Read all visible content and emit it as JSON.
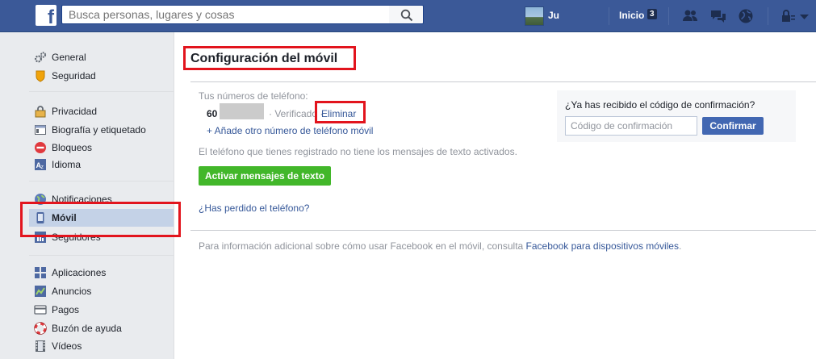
{
  "topbar": {
    "logo": "f",
    "search_placeholder": "Busca personas, lugares y cosas",
    "user_name": "Ju",
    "home_label": "Inicio",
    "home_count": "3",
    "icons": [
      "friends-icon",
      "messages-icon",
      "globe-icon",
      "lock-icon",
      "dropdown-icon"
    ]
  },
  "sidebar": {
    "items": [
      {
        "label": "General",
        "icon": "gears-icon"
      },
      {
        "label": "Seguridad",
        "icon": "shield-icon"
      },
      {
        "label": "Privacidad",
        "icon": "privacy-lock-icon"
      },
      {
        "label": "Biografía y etiquetado",
        "icon": "timeline-icon"
      },
      {
        "label": "Bloqueos",
        "icon": "block-icon"
      },
      {
        "label": "Idioma",
        "icon": "language-icon"
      },
      {
        "label": "Notificaciones",
        "icon": "globe-icon"
      },
      {
        "label": "Móvil",
        "icon": "mobile-icon",
        "active": true
      },
      {
        "label": "Seguidores",
        "icon": "rss-icon"
      },
      {
        "label": "Aplicaciones",
        "icon": "apps-icon"
      },
      {
        "label": "Anuncios",
        "icon": "ads-icon"
      },
      {
        "label": "Pagos",
        "icon": "card-icon"
      },
      {
        "label": "Buzón de ayuda",
        "icon": "lifebuoy-icon"
      },
      {
        "label": "Vídeos",
        "icon": "film-icon"
      }
    ]
  },
  "main": {
    "title": "Configuración del móvil",
    "phones_label": "Tus números de teléfono:",
    "phone_prefix": "60",
    "verified_label": "· Verificado ·",
    "remove_label": "Eliminar",
    "add_phone_label": "+ Añade otro número de teléfono móvil",
    "sms_note": "El teléfono que tienes registrado no tiene los mensajes de texto activados.",
    "activate_button": "Activar mensajes de texto",
    "lost_phone_link": "¿Has perdido el teléfono?",
    "info_text": "Para información adicional sobre cómo usar Facebook en el móvil, consulta ",
    "info_link": "Facebook para dispositivos móviles",
    "info_end": "."
  },
  "confirm": {
    "question": "¿Ya has recibido el código de confirmación?",
    "placeholder": "Código de confirmación",
    "button": "Confirmar"
  },
  "colors": {
    "brand": "#3b5998",
    "link": "#365899",
    "green": "#42b72a",
    "highlight": "#e2141d"
  }
}
